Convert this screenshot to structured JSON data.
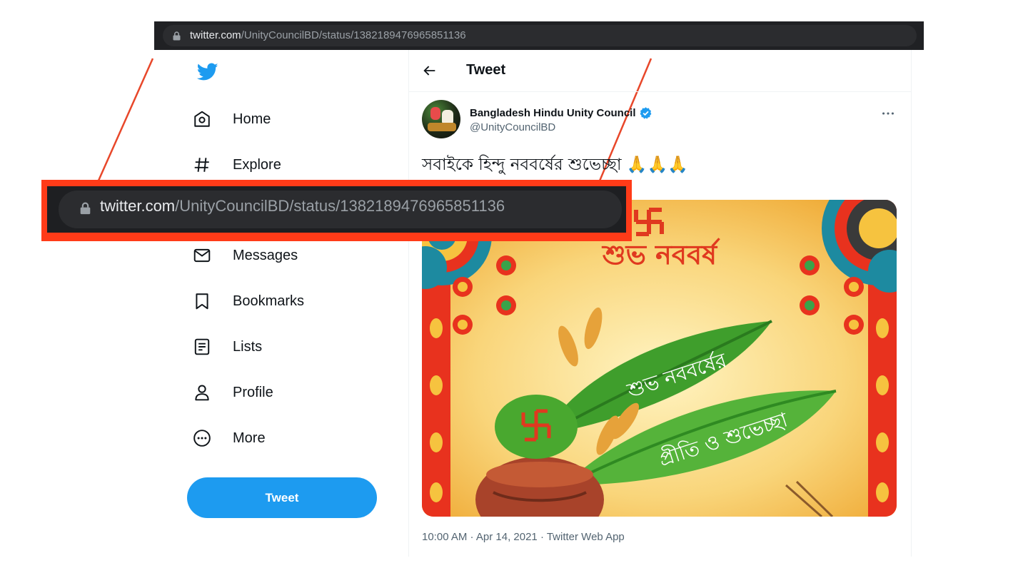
{
  "browser": {
    "url_host": "twitter.com",
    "url_path": "/UnityCouncilBD/status/1382189476965851136"
  },
  "sidebar": {
    "logo_icon": "twitter-bird-icon",
    "items": [
      {
        "label": "Home",
        "icon": "home-icon"
      },
      {
        "label": "Explore",
        "icon": "hashtag-icon"
      },
      {
        "label": "Messages",
        "icon": "mail-icon"
      },
      {
        "label": "Bookmarks",
        "icon": "bookmark-icon"
      },
      {
        "label": "Lists",
        "icon": "list-icon"
      },
      {
        "label": "Profile",
        "icon": "person-icon"
      },
      {
        "label": "More",
        "icon": "more-circle-icon"
      }
    ],
    "tweet_button": "Tweet"
  },
  "main": {
    "header_title": "Tweet",
    "author": {
      "display_name": "Bangladesh Hindu Unity Council",
      "handle": "@UnityCouncilBD",
      "verified": true
    },
    "tweet_text": "সবাইকে হিন্দু নববর্ষের শুভেচ্ছা 🙏🙏🙏",
    "image_text": {
      "top": "শুভ নববর্ষ",
      "leaf_line1": "শুভ নববর্ষের",
      "leaf_line2": "প্রীতি ও শুভেচ্ছা"
    },
    "timestamp": "10:00 AM · Apr 14, 2021 · Twitter Web App"
  },
  "colors": {
    "accent": "#1d9bf0",
    "highlight": "#ff3b18",
    "browser_bar": "#202124"
  }
}
